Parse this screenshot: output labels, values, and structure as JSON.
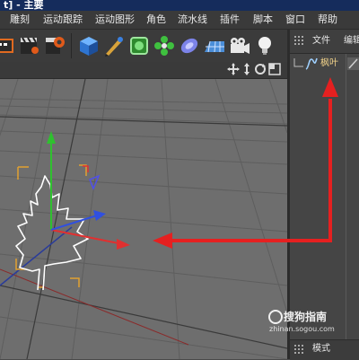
{
  "window": {
    "title": "t] - 主要"
  },
  "menu": [
    {
      "label": "雕刻"
    },
    {
      "label": "运动跟踪"
    },
    {
      "label": "运动图形"
    },
    {
      "label": "角色"
    },
    {
      "label": "流水线"
    },
    {
      "label": "插件"
    },
    {
      "label": "脚本"
    },
    {
      "label": "窗口"
    },
    {
      "label": "帮助"
    }
  ],
  "toolbar": {
    "buttons": [
      {
        "icon": "render-region-icon"
      },
      {
        "icon": "render-view-icon"
      },
      {
        "icon": "render-settings-icon"
      },
      {
        "icon": "cube-icon"
      },
      {
        "icon": "pen-icon"
      },
      {
        "icon": "subdivision-icon"
      },
      {
        "icon": "array-icon"
      },
      {
        "icon": "deformer-icon"
      },
      {
        "icon": "floor-icon"
      },
      {
        "icon": "camera-icon"
      },
      {
        "icon": "light-icon"
      }
    ]
  },
  "object_manager": {
    "tabs": [
      {
        "label": "文件"
      },
      {
        "label": "编辑"
      }
    ],
    "objects": [
      {
        "name": "枫叶",
        "icon": "spline-icon"
      }
    ]
  },
  "bottom_panel": {
    "tab_label": "模式"
  },
  "watermark": {
    "text": "搜狗指南",
    "url": "zhinan.sogou.com"
  },
  "colors": {
    "accent_arrow": "#e52020",
    "axis_y": "#2fc12f",
    "axis_x": "#e03030",
    "axis_z": "#3050e0"
  }
}
